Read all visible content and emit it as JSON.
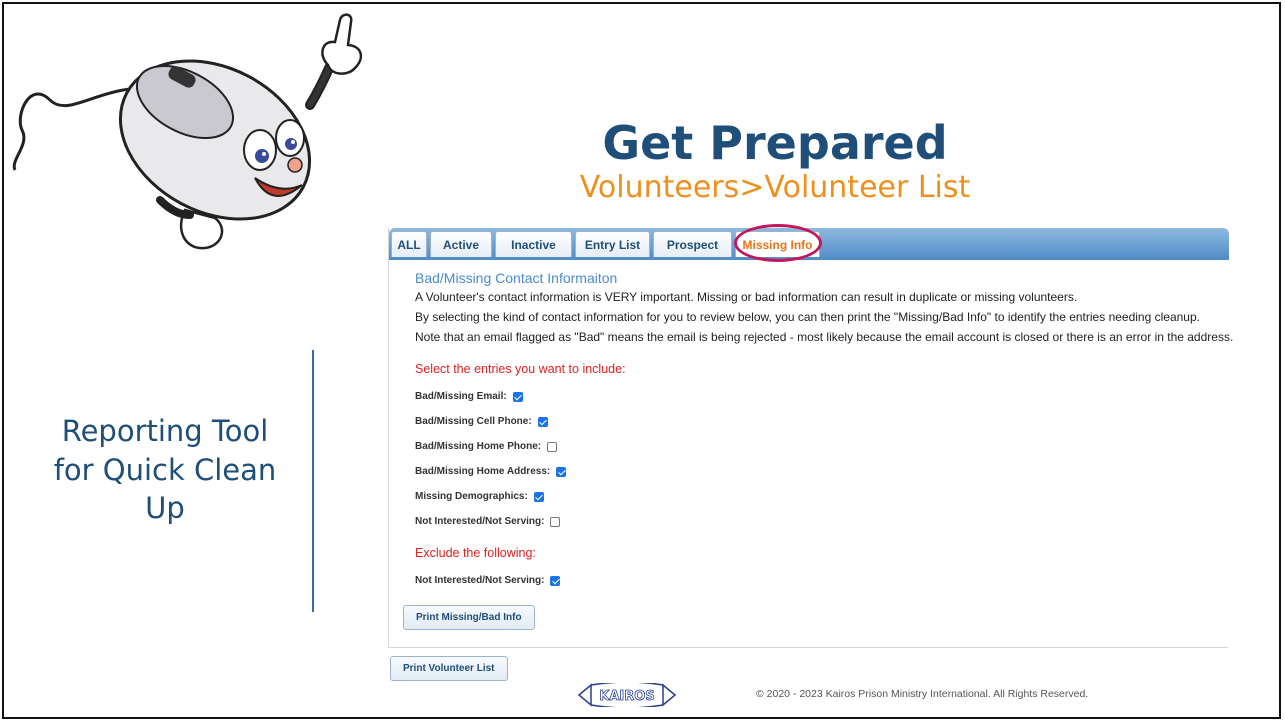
{
  "slide": {
    "title": "Get Prepared",
    "subtitle": "Volunteers>Volunteer List",
    "side_caption": "Reporting Tool for Quick Clean Up"
  },
  "tabs": [
    {
      "label": "ALL",
      "active": false
    },
    {
      "label": "Active",
      "active": false
    },
    {
      "label": "Inactive",
      "active": false
    },
    {
      "label": "Entry List",
      "active": false
    },
    {
      "label": "Prospect",
      "active": false
    },
    {
      "label": "Missing Info",
      "active": true
    }
  ],
  "content": {
    "section_title": "Bad/Missing Contact Informaiton",
    "para1": "A Volunteer's contact information is VERY important. Missing or bad information can result in duplicate or missing volunteers.",
    "para2": "By selecting the kind of contact information for you to review below, you can then print the \"Missing/Bad Info\" to identify the entries needing cleanup.",
    "para3": "Note that an email flagged as \"Bad\" means the email is being rejected - most likely because the email account is closed or there is an error in the address.",
    "include_heading": "Select the entries you want to include:",
    "include_options": [
      {
        "label": "Bad/Missing Email:",
        "checked": true
      },
      {
        "label": "Bad/Missing Cell Phone:",
        "checked": true
      },
      {
        "label": "Bad/Missing Home Phone:",
        "checked": false
      },
      {
        "label": "Bad/Missing Home Address:",
        "checked": true
      },
      {
        "label": "Missing Demographics:",
        "checked": true
      },
      {
        "label": "Not Interested/Not Serving:",
        "checked": false
      }
    ],
    "exclude_heading": "Exclude the following:",
    "exclude_options": [
      {
        "label": "Not Interested/Not Serving:",
        "checked": true
      }
    ],
    "print_missing_label": "Print Missing/Bad Info"
  },
  "print_list_label": "Print Volunteer List",
  "footer": {
    "logo_text": "KAIROS",
    "copyright": "© 2020 - 2023 Kairos Prison Ministry International. All Rights Reserved."
  },
  "colors": {
    "title": "#1f4e79",
    "subtitle": "#ef8f1e",
    "active_tab": "#e8741c",
    "highlight_ring": "#c2185b",
    "headings_red": "#e02020",
    "section_blue": "#4a8ccc"
  }
}
